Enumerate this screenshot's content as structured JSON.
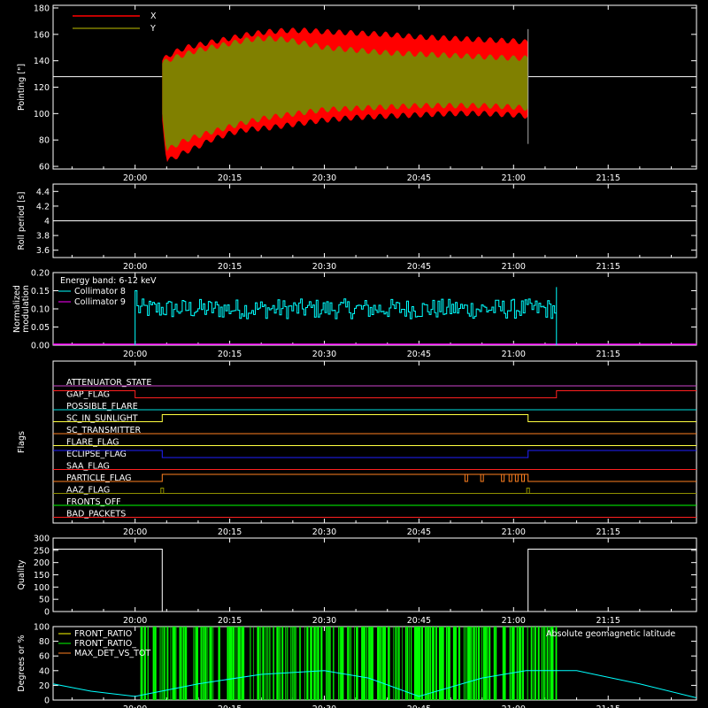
{
  "time_ticks": [
    "20:00",
    "20:15",
    "20:30",
    "20:45",
    "21:00",
    "21:15"
  ],
  "time_tick_minutes": [
    0,
    15,
    30,
    45,
    60,
    75
  ],
  "time_range_minutes": [
    -13,
    89
  ],
  "chart_data": [
    {
      "type": "area",
      "ylabel": "Pointing [\"]",
      "ylim": [
        58,
        182
      ],
      "yticks": [
        60,
        80,
        100,
        120,
        140,
        160,
        180
      ],
      "legend": [
        {
          "name": "X",
          "color": "#ff0000"
        },
        {
          "name": "Y",
          "color": "#808000"
        }
      ],
      "reference_line": {
        "y": 128,
        "color": "#ffffff"
      },
      "x_range_minutes": [
        4.3,
        62.3
      ],
      "series": [
        {
          "name": "X",
          "color": "#ff0000",
          "x": [
            4.3,
            5,
            6,
            8,
            10,
            12,
            15,
            18,
            21,
            24,
            27,
            30,
            35,
            40,
            45,
            50,
            55,
            60,
            62.3
          ],
          "upper": [
            140,
            143,
            146,
            150,
            152,
            154,
            157,
            160,
            162,
            163,
            163,
            162,
            161,
            160,
            158,
            157,
            156,
            155,
            154
          ],
          "lower": [
            95,
            64,
            66,
            71,
            75,
            80,
            85,
            88,
            89,
            91,
            93,
            95,
            97,
            98,
            99,
            100,
            100,
            99,
            98
          ]
        },
        {
          "name": "Y",
          "color": "#808000",
          "x": [
            4.3,
            5,
            6,
            8,
            10,
            12,
            15,
            18,
            21,
            24,
            27,
            30,
            35,
            40,
            45,
            50,
            55,
            60,
            62.3
          ],
          "upper": [
            138,
            140,
            142,
            145,
            148,
            150,
            153,
            156,
            157,
            156,
            153,
            150,
            148,
            146,
            145,
            144,
            143,
            142,
            142
          ],
          "lower": [
            100,
            72,
            75,
            80,
            83,
            86,
            90,
            94,
            97,
            99,
            101,
            103,
            104,
            105,
            106,
            106,
            106,
            105,
            104
          ]
        }
      ]
    },
    {
      "type": "line",
      "ylabel": "Roll period [s]",
      "ylim": [
        3.5,
        4.5
      ],
      "yticks": [
        3.6,
        3.8,
        4.0,
        4.2,
        4.4
      ],
      "series": [
        {
          "color": "#ffffff",
          "x": [
            -13,
            89
          ],
          "values": [
            4.0,
            4.0
          ]
        }
      ]
    },
    {
      "type": "line",
      "ylabel": "Normalized modulation",
      "ylim": [
        0,
        0.2
      ],
      "yticks": [
        "0.00",
        "0.05",
        "0.10",
        "0.15",
        "0.20"
      ],
      "annotation": "Energy band: 6-12 keV",
      "legend": [
        {
          "name": "Collimator 8",
          "color": "#00ffff"
        },
        {
          "name": "Collimator 9",
          "color": "#ff00ff"
        }
      ],
      "series": [
        {
          "name": "Collimator 8",
          "color": "#00ffff",
          "x_range_minutes": [
            0,
            66.8
          ],
          "typical": 0.1,
          "min": 0.075,
          "max": 0.13,
          "spikes": [
            {
              "x": 0,
              "value": 0.15
            },
            {
              "x": 66.8,
              "value": 0.16
            }
          ]
        },
        {
          "name": "Collimator 9",
          "color": "#ff00ff",
          "values_constant": 0.0
        }
      ]
    },
    {
      "type": "line",
      "ylabel": "Flags",
      "series": [
        {
          "name": "ATTENUATOR_STATE",
          "color": "#cc44cc",
          "segments": [
            [
              -13,
              89,
              0
            ]
          ]
        },
        {
          "name": "GAP_FLAG",
          "color": "#ff2020",
          "segments": [
            [
              -13,
              0,
              1
            ],
            [
              0,
              66.8,
              0
            ],
            [
              66.8,
              89,
              1
            ]
          ]
        },
        {
          "name": "POSSIBLE_FLARE",
          "color": "#00e0e0",
          "segments": [
            [
              -13,
              89,
              0
            ]
          ]
        },
        {
          "name": "SC_IN_SUNLIGHT",
          "color": "#ffff40",
          "segments": [
            [
              -13,
              4.3,
              0
            ],
            [
              4.3,
              62.3,
              1
            ],
            [
              62.3,
              89,
              0
            ]
          ]
        },
        {
          "name": "SC_TRANSMITTER",
          "color": "#ff8020",
          "segments": [
            [
              -13,
              89,
              0
            ]
          ]
        },
        {
          "name": "FLARE_FLAG",
          "color": "#ffff40",
          "segments": [
            [
              -13,
              89,
              0
            ]
          ]
        },
        {
          "name": "ECLIPSE_FLAG",
          "color": "#2020ff",
          "segments": [
            [
              -13,
              4.3,
              1
            ],
            [
              4.3,
              62.3,
              0
            ],
            [
              62.3,
              89,
              1
            ]
          ]
        },
        {
          "name": "SAA_FLAG",
          "color": "#ff2020",
          "segments": [
            [
              -13,
              89,
              0
            ]
          ]
        },
        {
          "name": "PARTICLE_FLAG",
          "color": "#ff8020",
          "segments": [
            [
              -13,
              4.3,
              0
            ],
            [
              4.3,
              62.3,
              1
            ],
            [
              62.3,
              89,
              0
            ]
          ],
          "pulses": [
            52.5,
            55,
            58.3,
            59.5,
            60.5,
            61.5
          ]
        },
        {
          "name": "AAZ_FLAG",
          "color": "#909000",
          "segments": [
            [
              -13,
              89,
              0
            ]
          ],
          "pulses": [
            4.3,
            62.3
          ]
        },
        {
          "name": "FRONTS_OFF",
          "color": "#00ff00",
          "segments": [
            [
              -13,
              89,
              0
            ]
          ]
        },
        {
          "name": "BAD_PACKETS",
          "color": "#ff2020",
          "segments": [
            [
              -13,
              89,
              0
            ]
          ]
        }
      ]
    },
    {
      "type": "line",
      "ylabel": "Quality",
      "ylim": [
        0,
        300
      ],
      "yticks": [
        0,
        50,
        100,
        150,
        200,
        250,
        300
      ],
      "series": [
        {
          "color": "#ffffff",
          "x": [
            -13,
            4.3,
            4.3,
            62.3,
            62.3,
            89
          ],
          "values": [
            255,
            255,
            0,
            0,
            255,
            255
          ]
        }
      ]
    },
    {
      "type": "line",
      "ylabel": "Degrees or %",
      "ylim": [
        0,
        100
      ],
      "yticks": [
        0,
        20,
        40,
        60,
        80,
        100
      ],
      "legend": [
        {
          "name": "FRONT_RATIO",
          "color": "#ffff00"
        },
        {
          "name": "FRONT_RATIO_",
          "color": "#00ff00"
        },
        {
          "name": "MAX_DET_VS_TOT",
          "color": "#ff8020"
        }
      ],
      "annotation": "Absolute geomagnetic latitude",
      "annotation_color": "#00ffff",
      "series": [
        {
          "name": "Absolute geomagnetic latitude",
          "color": "#00ffff",
          "x": [
            -13,
            -7,
            0,
            10,
            20,
            30,
            37,
            45,
            55,
            62,
            70,
            80,
            89
          ],
          "values": [
            22,
            12,
            5,
            22,
            35,
            40,
            30,
            5,
            30,
            40,
            40,
            22,
            3
          ]
        },
        {
          "name": "FRONT_RATIO_",
          "color": "#00ff00",
          "x_range_minutes": [
            0,
            66.8
          ],
          "typical": 100
        }
      ]
    }
  ]
}
